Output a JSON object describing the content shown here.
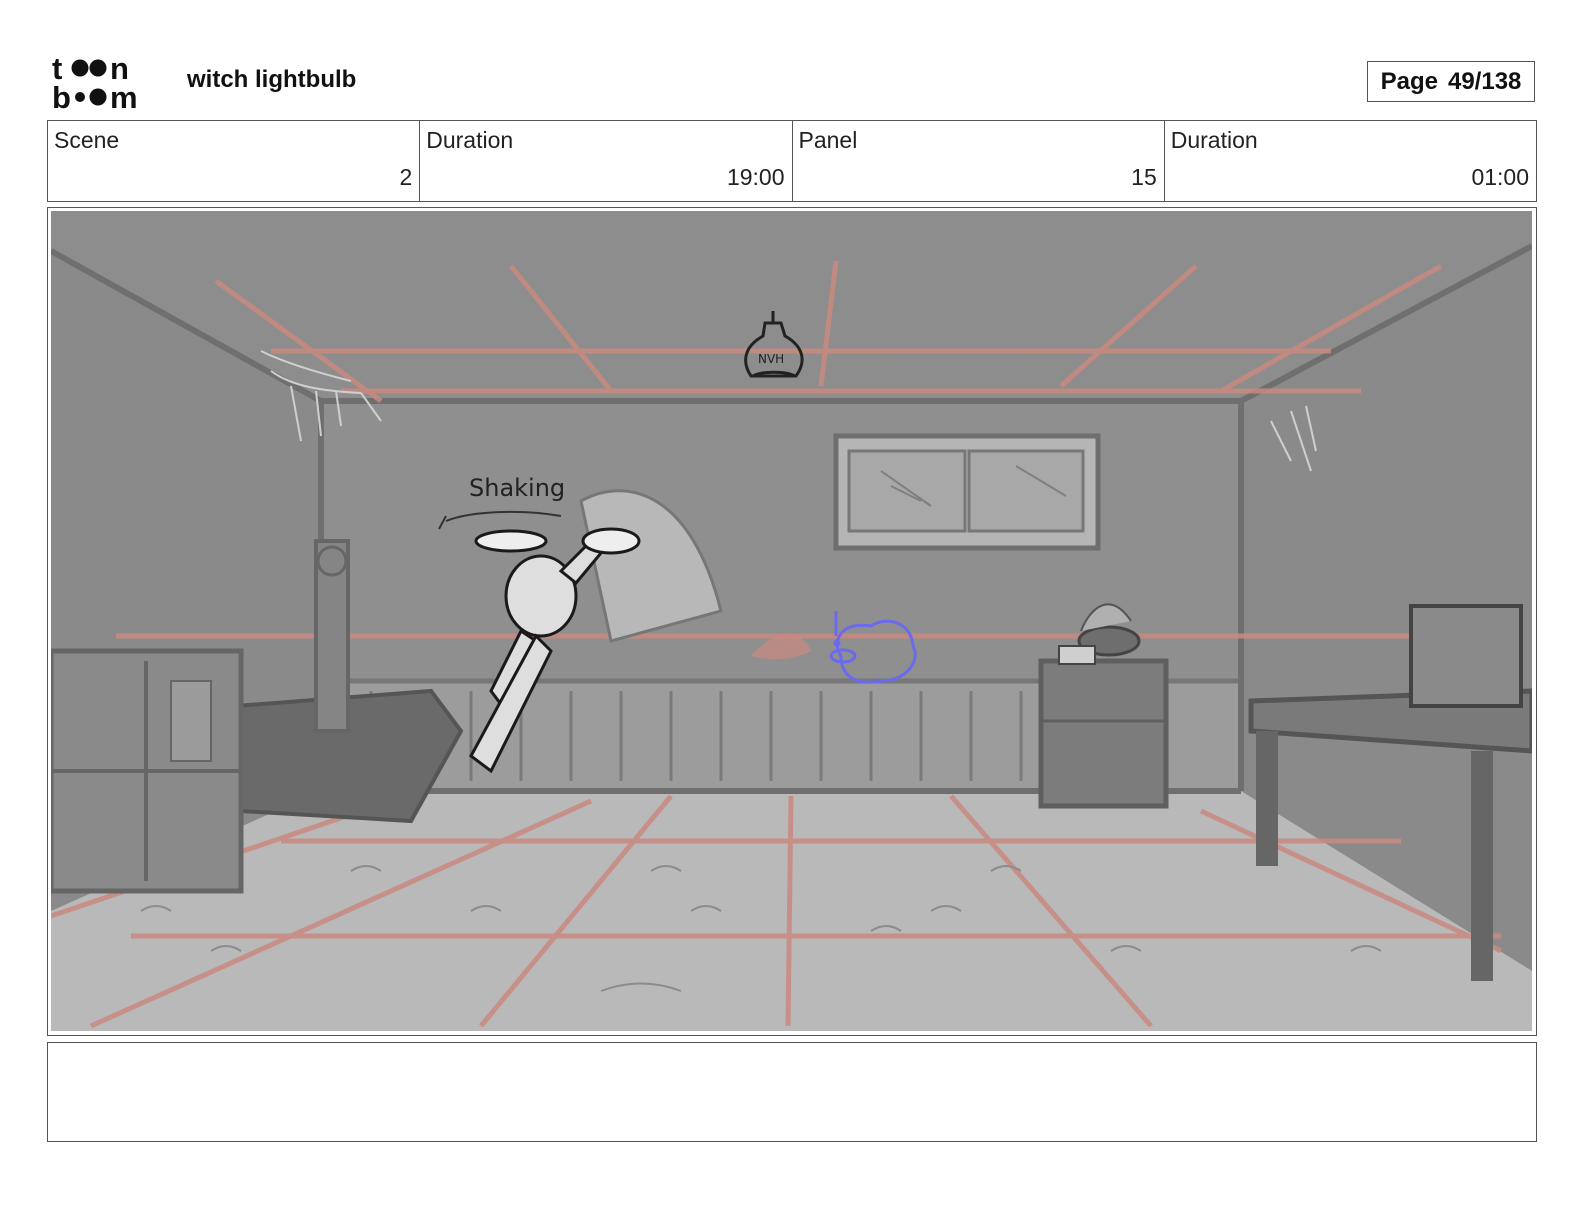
{
  "header": {
    "logo_alt": "toon boom",
    "project_title": "witch lightbulb",
    "page_label": "Page",
    "page_value": "49/138"
  },
  "info": {
    "scene_label": "Scene",
    "scene_value": "2",
    "scene_duration_label": "Duration",
    "scene_duration_value": "19:00",
    "panel_label": "Panel",
    "panel_value": "15",
    "panel_duration_label": "Duration",
    "panel_duration_value": "01:00"
  },
  "panel": {
    "annotation": "Shaking",
    "bulb_label": "NVH"
  },
  "notes": {
    "text": ""
  },
  "colors": {
    "sketch_bg": "#9a9a9a",
    "perspective_lines": "#c98a80",
    "character_blue": "#6a6af0"
  }
}
